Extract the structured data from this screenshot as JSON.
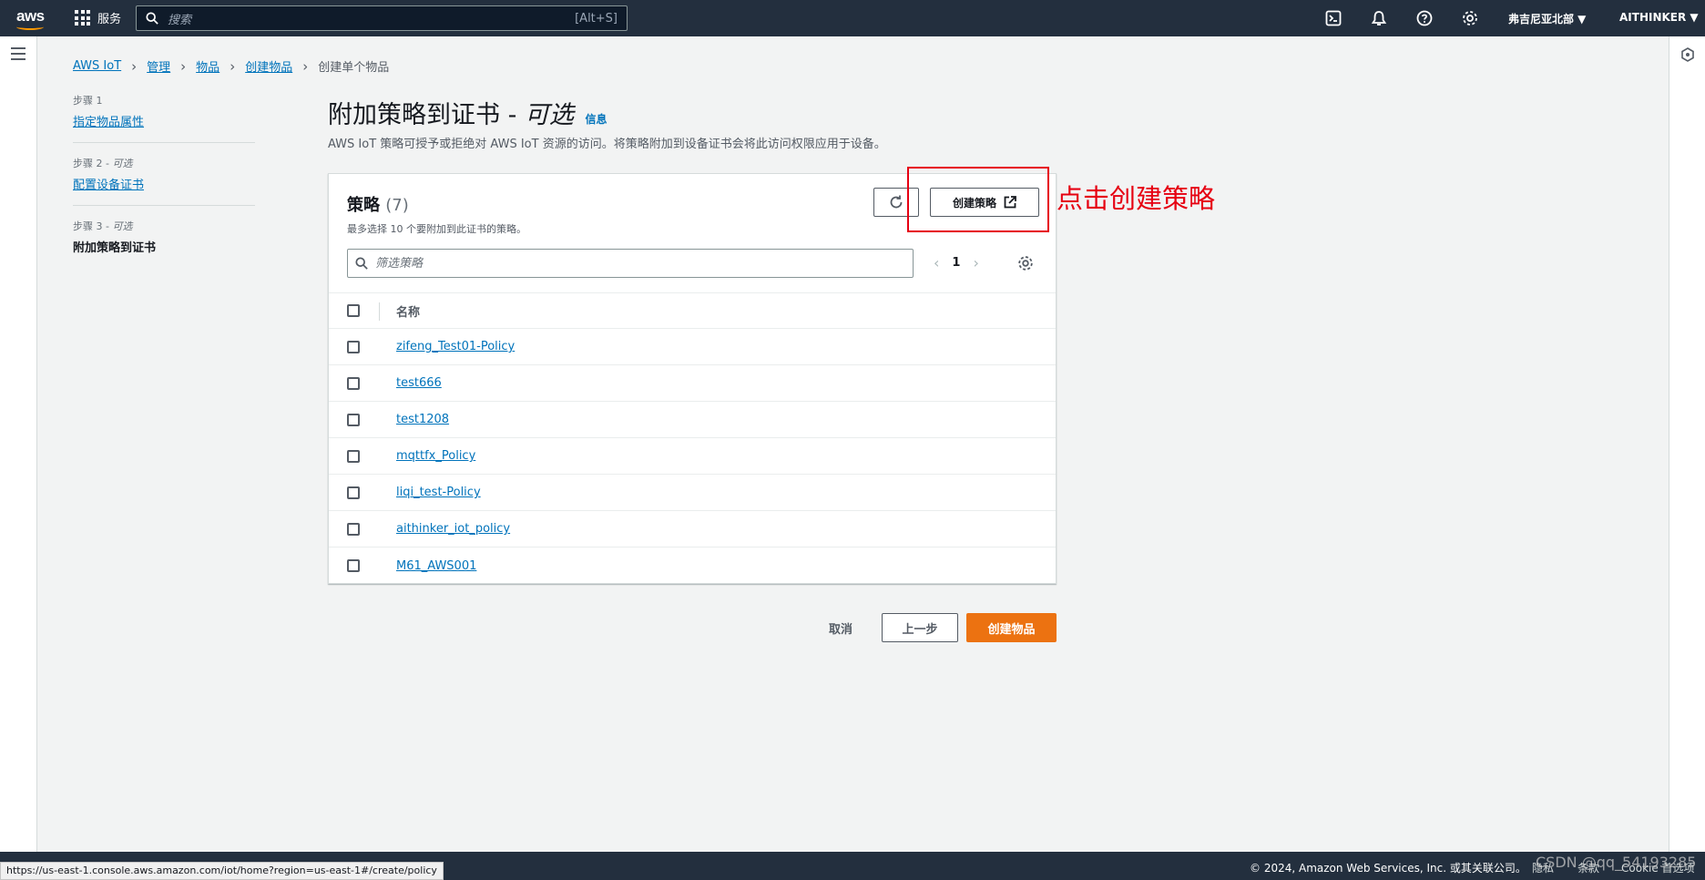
{
  "topnav": {
    "logo_text": "aws",
    "services_label": "服务",
    "search_placeholder": "搜索",
    "search_shortcut": "[Alt+S]",
    "region": "弗吉尼亚北部 ▼",
    "account": "AITHINKER ▼"
  },
  "breadcrumb": {
    "items": [
      "AWS IoT",
      "管理",
      "物品",
      "创建物品"
    ],
    "current": "创建单个物品"
  },
  "steps": [
    {
      "label": "步骤 1",
      "label_suffix": "",
      "title": "指定物品属性"
    },
    {
      "label": "步骤 2 - ",
      "label_suffix": "可选",
      "title": "配置设备证书"
    },
    {
      "label": "步骤 3 - ",
      "label_suffix": "可选",
      "title": "附加策略到证书"
    }
  ],
  "header": {
    "title": "附加策略到证书 - ",
    "title_italic": "可选",
    "info": "信息",
    "description": "AWS IoT 策略可授予或拒绝对 AWS IoT 资源的访问。将策略附加到设备证书会将此访问权限应用于设备。"
  },
  "policies": {
    "title": "策略",
    "count": "(7)",
    "subtitle": "最多选择 10 个要附加到此证书的策略。",
    "create_button": "创建策略",
    "filter_placeholder": "筛选策略",
    "page": "1",
    "column_name": "名称",
    "rows": [
      "zifeng_Test01-Policy",
      "test666",
      "test1208",
      "mqttfx_Policy",
      "liqi_test-Policy",
      "aithinker_iot_policy",
      "M61_AWS001"
    ]
  },
  "actions": {
    "cancel": "取消",
    "previous": "上一步",
    "create": "创建物品"
  },
  "annotation": "点击创建策略",
  "footer": {
    "copyright": "© 2024, Amazon Web Services, Inc. 或其关联公司。",
    "privacy": "隐私",
    "terms": "条款",
    "cookie": "Cookie 首选项",
    "status_url": "https://us-east-1.console.aws.amazon.com/iot/home?region=us-east-1#/create/policy",
    "watermark": "CSDN @qq_54193285"
  },
  "colors": {
    "nav_bg": "#232f3e",
    "link": "#0073bb",
    "primary": "#ec7211",
    "annotation": "#e60012"
  }
}
